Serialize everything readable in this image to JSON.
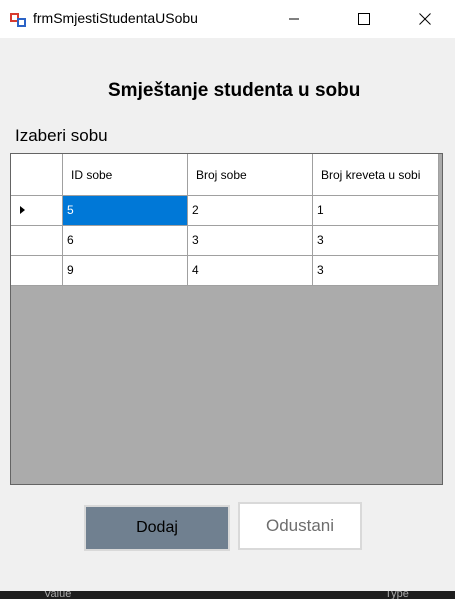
{
  "window": {
    "title": "frmSmjestiStudentaUSobu"
  },
  "form": {
    "heading": "Smještanje studenta u sobu",
    "label": "Izaberi sobu"
  },
  "grid": {
    "columns": [
      "ID sobe",
      "Broj sobe",
      "Broj kreveta u sobi"
    ],
    "rows": [
      {
        "cells": [
          "5",
          "2",
          "1"
        ],
        "current": true
      },
      {
        "cells": [
          "6",
          "3",
          "3"
        ],
        "current": false
      },
      {
        "cells": [
          "9",
          "4",
          "3"
        ],
        "current": false
      }
    ]
  },
  "buttons": {
    "add": "Dodaj",
    "cancel": "Odustani"
  },
  "background_strip": {
    "left": "Value",
    "right": "Type"
  },
  "colors": {
    "selection": "#0078d7",
    "add_button": "#708090",
    "grid_background": "#ababab"
  }
}
